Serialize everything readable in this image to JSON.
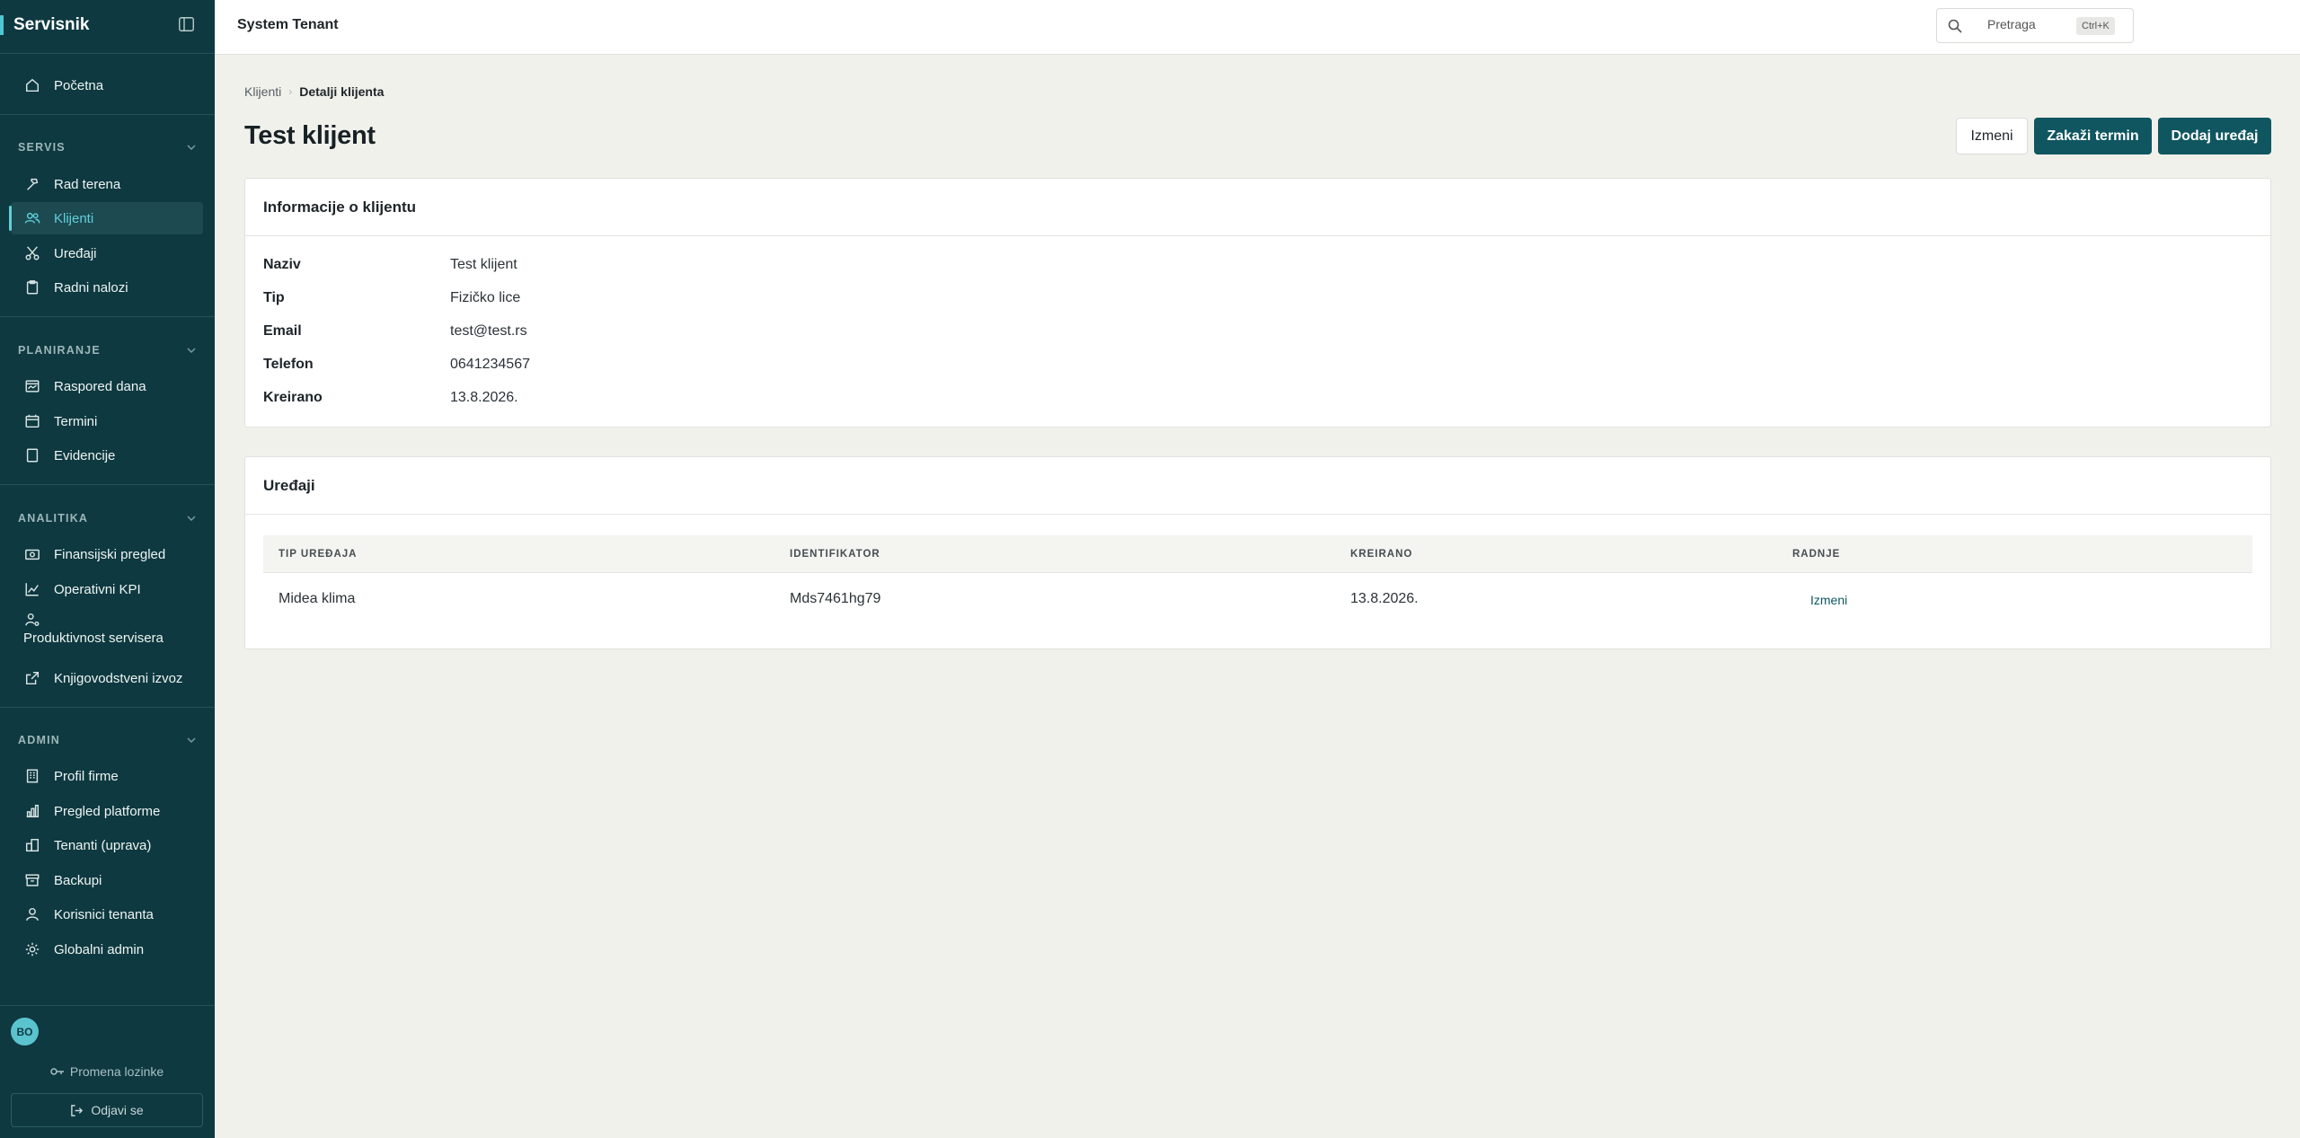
{
  "brand": "Servisnik",
  "tenant": "System Tenant",
  "search": {
    "placeholder": "Pretraga",
    "shortcut": "Ctrl+K"
  },
  "sidebar": {
    "home": "Početna",
    "sections": [
      {
        "title": "SERVIS",
        "items": [
          "Rad terena",
          "Klijenti",
          "Uređaji",
          "Radni nalozi"
        ]
      },
      {
        "title": "PLANIRANJE",
        "items": [
          "Raspored dana",
          "Termini",
          "Evidencije"
        ]
      },
      {
        "title": "ANALITIKA",
        "items": [
          "Finansijski pregled",
          "Operativni KPI",
          "Produktivnost servisera",
          "Knjigovodstveni izvoz"
        ]
      },
      {
        "title": "ADMIN",
        "items": [
          "Profil firme",
          "Pregled platforme",
          "Tenanti (uprava)",
          "Backupi",
          "Korisnici tenanta",
          "Globalni admin"
        ]
      }
    ],
    "active": "Klijenti",
    "avatar": "BO",
    "change_password": "Promena lozinke",
    "logout": "Odjavi se"
  },
  "breadcrumb": {
    "parent": "Klijenti",
    "current": "Detalji klijenta"
  },
  "page": {
    "title": "Test klijent",
    "buttons": {
      "edit": "Izmeni",
      "schedule": "Zakaži termin",
      "add_device": "Dodaj uređaj"
    }
  },
  "info": {
    "title": "Informacije o klijentu",
    "rows": [
      {
        "label": "Naziv",
        "value": "Test klijent"
      },
      {
        "label": "Tip",
        "value": "Fizičko lice"
      },
      {
        "label": "Email",
        "value": "test@test.rs"
      },
      {
        "label": "Telefon",
        "value": "0641234567"
      },
      {
        "label": "Kreirano",
        "value": "13.8.2026."
      }
    ]
  },
  "devices": {
    "title": "Uređaji",
    "columns": [
      "TIP UREĐAJA",
      "IDENTIFIKATOR",
      "KREIRANO",
      "RADNJE"
    ],
    "rows": [
      {
        "type": "Midea klima",
        "id": "Mds7461hg79",
        "created": "13.8.2026.",
        "action": "Izmeni"
      }
    ]
  },
  "colors": {
    "sidebar": "#0e3940",
    "accent": "#5fd0da",
    "primary": "#0f5660",
    "background": "#f1f1ec"
  }
}
